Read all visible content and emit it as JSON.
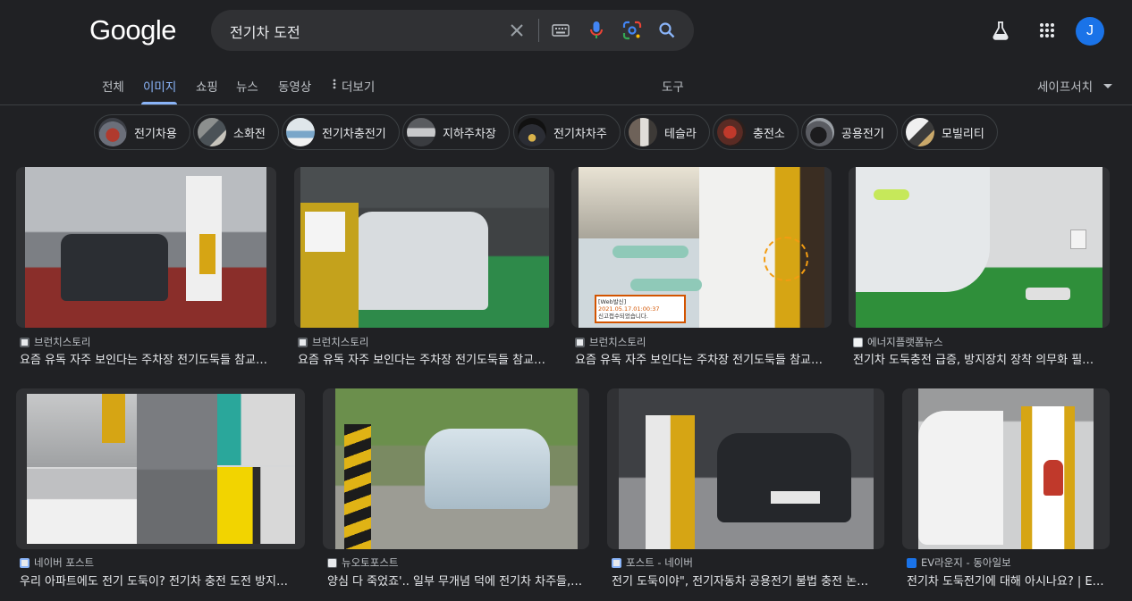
{
  "header": {
    "logo": "Google",
    "query": "전기차 도전",
    "avatar_letter": "J"
  },
  "tabs": {
    "all": "전체",
    "images": "이미지",
    "shopping": "쇼핑",
    "news": "뉴스",
    "videos": "동영상",
    "more": "더보기",
    "tools": "도구",
    "safesearch": "세이프서치"
  },
  "chips": [
    {
      "label": "전기차용"
    },
    {
      "label": "소화전"
    },
    {
      "label": "전기차충전기"
    },
    {
      "label": "지하주차장"
    },
    {
      "label": "전기차차주"
    },
    {
      "label": "테슬라"
    },
    {
      "label": "충전소"
    },
    {
      "label": "공용전기"
    },
    {
      "label": "모빌리티"
    }
  ],
  "results": [
    {
      "source": "브런치스토리",
      "title": "요즘 유독 자주 보인다는 주차장 전기도둑들 참교…"
    },
    {
      "source": "브런치스토리",
      "title": "요즘 유독 자주 보인다는 주차장 전기도둑들 참교…"
    },
    {
      "source": "브런치스토리",
      "title": "요즘 유독 자주 보인다는 주차장 전기도둑들 참교…"
    },
    {
      "source": "에너지플랫폼뉴스",
      "title": "전기차 도둑충전 급증, 방지장치 장착 의무화 필…"
    },
    {
      "source": "네이버 포스트",
      "title": "우리 아파트에도 전기 도둑이? 전기차 충전 도전 방지…"
    },
    {
      "source": "뉴오토포스트",
      "title": "양심 다 죽었죠'.. 일부 무개념 덕에 전기차 차주들,…"
    },
    {
      "source": "포스트 - 네이버",
      "title": "전기 도둑이야\", 전기자동차 공용전기 불법 충전 논…"
    },
    {
      "source": "EV라운지 - 동아일보",
      "title": "전기차 도둑전기에 대해 아시나요? | E…"
    }
  ],
  "screenshot_texts": {
    "chat_badge": "[Web발신]",
    "chat_date": "2021.05.17.01:00:37",
    "chat_line": "신고접수되었습니다."
  }
}
